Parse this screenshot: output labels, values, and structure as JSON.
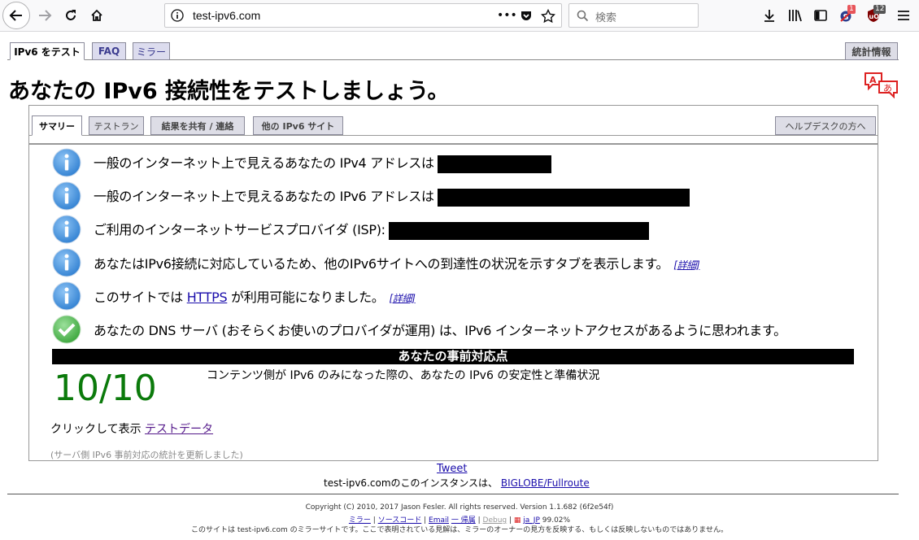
{
  "browser": {
    "url": "test-ipv6.com",
    "search_placeholder": "検索",
    "badge_1": "1",
    "badge_2": "12"
  },
  "site_tabs": {
    "test": "IPv6 をテスト",
    "faq": "FAQ",
    "mirror": "ミラー",
    "stats": "統計情報"
  },
  "page_title": "あなたの IPv6 接続性をテストしましょう。",
  "sub_tabs": {
    "summary": "サマリー",
    "test_run": "テストラン",
    "share": "結果を共有 / 連絡",
    "other_sites": "他の IPv6 サイト",
    "helpdesk": "ヘルプデスクの方へ"
  },
  "results": [
    {
      "text": "一般のインターネット上で見えるあなたの IPv4 アドレスは",
      "icon": "info-icon"
    },
    {
      "text": "一般のインターネット上で見えるあなたの IPv6 アドレスは",
      "icon": "info-icon"
    },
    {
      "text": "ご利用のインターネットサービスプロバイダ (ISP):",
      "icon": "info-icon"
    },
    {
      "text": "あなたはIPv6接続に対応しているため、他のIPv6サイトへの到達性の状況を示すタブを表示します。",
      "link": "[詳細]",
      "icon": "info-icon"
    },
    {
      "text_before": "このサイトでは",
      "link_https": "HTTPS",
      "text_after": "が利用可能になりました。",
      "link": "[詳細]",
      "icon": "info-icon"
    },
    {
      "text": "あなたの DNS サーバ (おそらくお使いのプロバイダが運用) は、IPv6 インターネットアクセスがあるように思われます。",
      "icon": "check-icon"
    }
  ],
  "score": {
    "header": "あなたの事前対応点",
    "value": "10/10",
    "description": "コンテンツ側が IPv6 のみになった際の、あなたの IPv6 の安定性と準備状況"
  },
  "click_show": {
    "label": "クリックして表示",
    "link": "テストデータ"
  },
  "stats_note": "(サーバ側 IPv6 事前対応の統計を更新しました)",
  "tweet": "Tweet",
  "instance": {
    "text": "test-ipv6.comのこのインスタンスは、",
    "link": "BIGLOBE/Fullroute"
  },
  "footer": {
    "copyright": "Copyright (C) 2010, 2017 Jason Fesler. All rights reserved. Version 1.1.682 (6f2e54f)",
    "links": [
      "ミラー",
      "ソースコード",
      "Email",
      "一 帰属",
      "Debug",
      "ja_JP"
    ],
    "percent": "99.02%",
    "disclaimer": "このサイトは test-ipv6.com のミラーサイトです。ここで表明されている見解は、ミラーのオーナーの見方を反映する、もしくは反映しないものではありません。"
  },
  "colors": {
    "info_blue": "#2f7fd1",
    "check_green": "#3aa53a",
    "score_green": "#0b7a0b",
    "tab_bg": "#dcdcee"
  }
}
